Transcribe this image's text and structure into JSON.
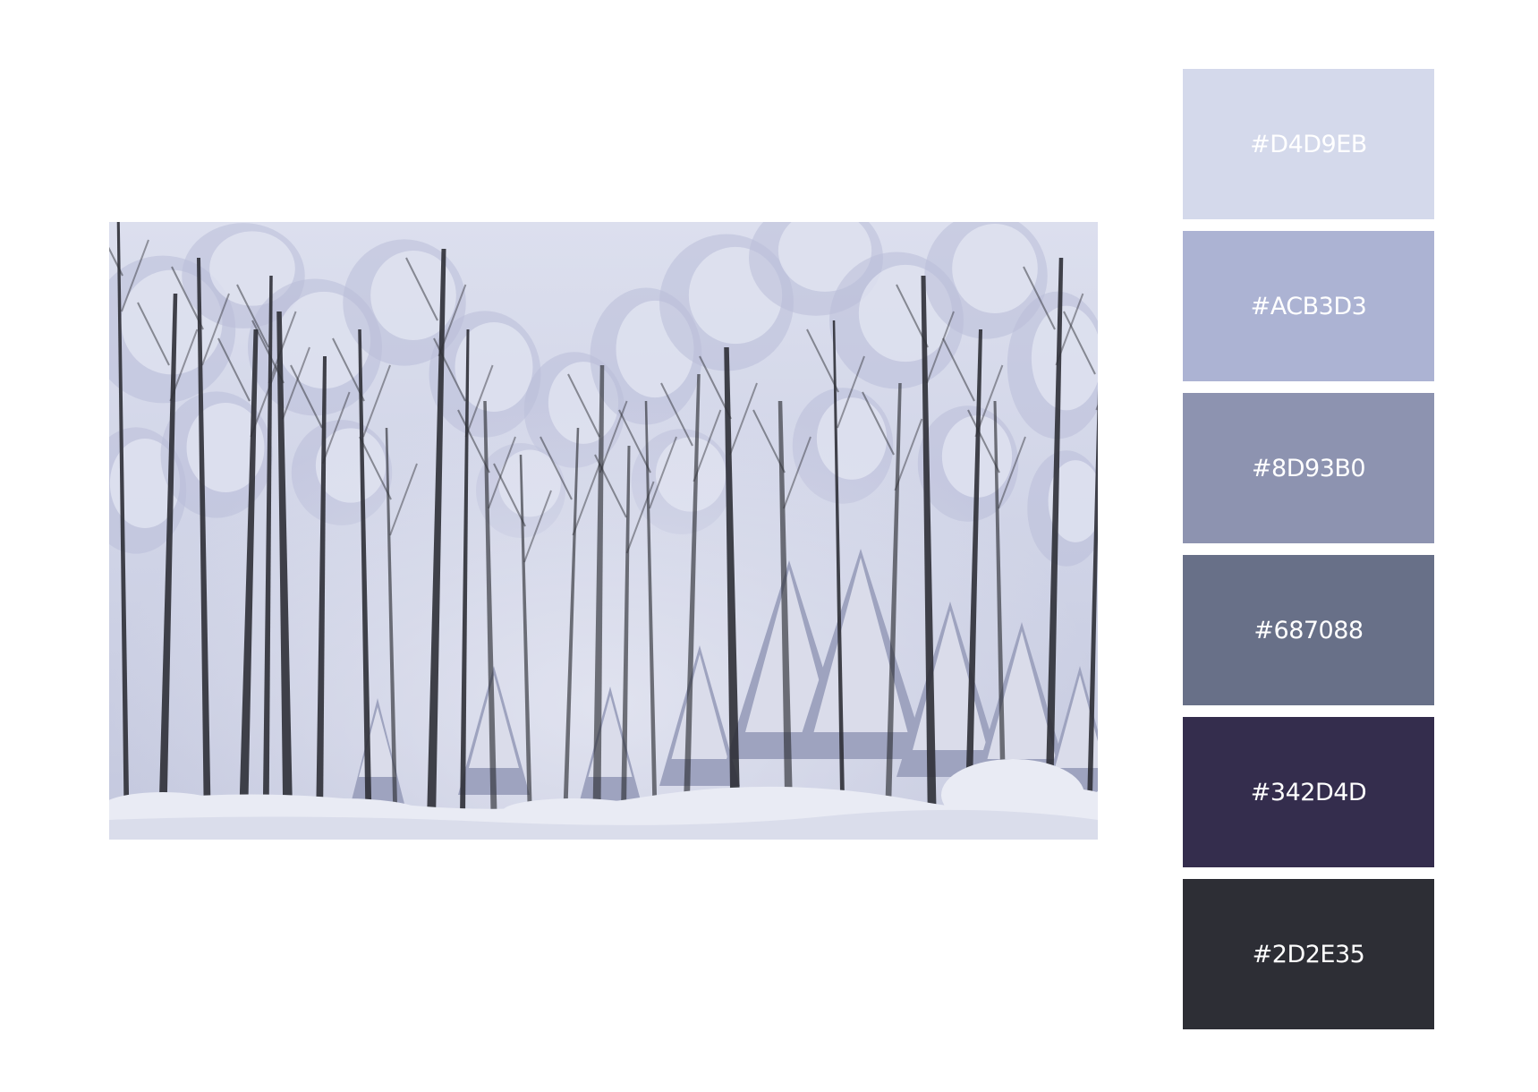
{
  "photo": {
    "subject": "winter-forest-photo",
    "sky_color": "#D9DCEB",
    "snow_color": "#E9EBF4",
    "trunk_color": "#2E2F36",
    "foliage_color": "#B9BED8"
  },
  "palette": {
    "swatches": [
      {
        "hex": "#D4D9EB",
        "label": "#D4D9EB"
      },
      {
        "hex": "#ACB3D3",
        "label": "#ACB3D3"
      },
      {
        "hex": "#8D93B0",
        "label": "#8D93B0"
      },
      {
        "hex": "#687088",
        "label": "#687088"
      },
      {
        "hex": "#342D4D",
        "label": "#342D4D"
      },
      {
        "hex": "#2D2E35",
        "label": "#2D2E35"
      }
    ]
  }
}
